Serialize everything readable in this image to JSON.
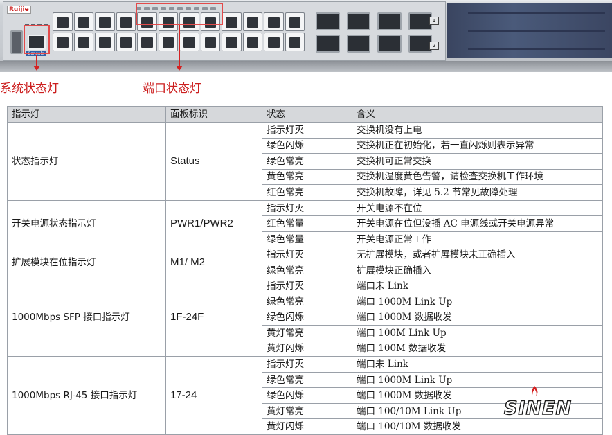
{
  "device": {
    "brand": "Ruijie",
    "console_label": "Console",
    "slot_labels": [
      "1",
      "2"
    ]
  },
  "callouts": {
    "system_led": "系统状态灯",
    "port_led": "端口状态灯"
  },
  "table": {
    "headers": [
      "指示灯",
      "面板标识",
      "状态",
      "含义"
    ],
    "groups": [
      {
        "name": "状态指示灯",
        "code": "Status",
        "rows": [
          {
            "state": "指示灯灭",
            "meaning": "交换机没有上电"
          },
          {
            "state": "绿色闪烁",
            "meaning": "交换机正在初始化，若一直闪烁则表示异常"
          },
          {
            "state": "绿色常亮",
            "meaning": "交换机可正常交换"
          },
          {
            "state": "黄色常亮",
            "meaning": "交换机温度黄色告警，请检查交换机工作环境"
          },
          {
            "state": "红色常亮",
            "meaning": "交换机故障，详见 5.2 节常见故障处理"
          }
        ]
      },
      {
        "name": "开关电源状态指示灯",
        "code": "PWR1/PWR2",
        "rows": [
          {
            "state": "指示灯灭",
            "meaning": "开关电源不在位"
          },
          {
            "state": "红色常量",
            "meaning": "开关电源在位但没插 AC 电源线或开关电源异常"
          },
          {
            "state": "绿色常量",
            "meaning": "开关电源正常工作"
          }
        ]
      },
      {
        "name": "扩展模块在位指示灯",
        "code": "M1/ M2",
        "rows": [
          {
            "state": "指示灯灭",
            "meaning": "无扩展模块，或者扩展模块未正确插入"
          },
          {
            "state": "绿色常亮",
            "meaning": "扩展模块正确插入"
          }
        ]
      },
      {
        "name": "1000Mbps SFP 接口指示灯",
        "code": "1F-24F",
        "rows": [
          {
            "state": "指示灯灭",
            "meaning": "端口未 Link"
          },
          {
            "state": "绿色常亮",
            "meaning": "端口 1000M Link Up"
          },
          {
            "state": "绿色闪烁",
            "meaning": "端口 1000M 数据收发"
          },
          {
            "state": "黄灯常亮",
            "meaning": "端口 100M Link Up"
          },
          {
            "state": "黄灯闪烁",
            "meaning": "端口 100M 数据收发"
          }
        ]
      },
      {
        "name": "1000Mbps RJ-45 接口指示灯",
        "code": "17-24",
        "rows": [
          {
            "state": "指示灯灭",
            "meaning": "端口未 Link"
          },
          {
            "state": "绿色常亮",
            "meaning": "端口 1000M Link Up"
          },
          {
            "state": "绿色闪烁",
            "meaning": "端口 1000M 数据收发"
          },
          {
            "state": "黄灯常亮",
            "meaning": "端口 100/10M Link Up"
          },
          {
            "state": "黄灯闪烁",
            "meaning": "端口 100/10M 数据收发"
          }
        ]
      }
    ]
  },
  "watermark": {
    "text": "SINEN",
    "icon": "flame-icon"
  },
  "colors": {
    "accent_red": "#cc1f1f",
    "header_bg": "#d6d8db",
    "panel_blue": "#3a4560"
  }
}
